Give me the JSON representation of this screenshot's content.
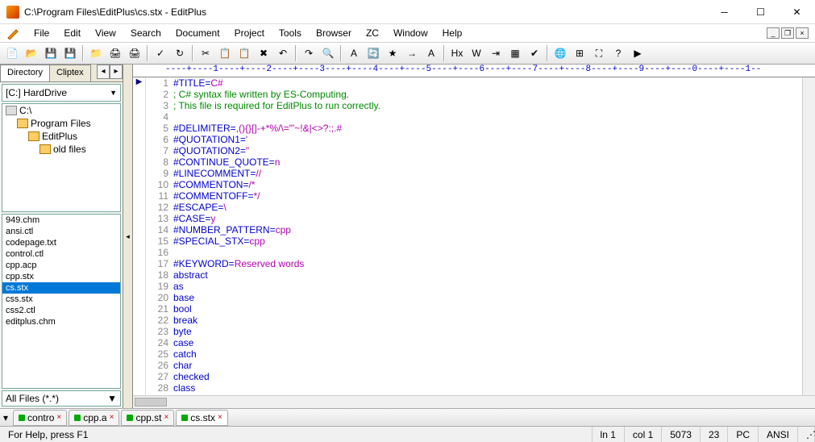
{
  "title": "C:\\Program Files\\EditPlus\\cs.stx - EditPlus",
  "menus": [
    "File",
    "Edit",
    "View",
    "Search",
    "Document",
    "Project",
    "Tools",
    "Browser",
    "ZC",
    "Window",
    "Help"
  ],
  "sidebar": {
    "tabs": [
      "Directory",
      "Cliptex"
    ],
    "drive": "[C:] HardDrive",
    "folders": [
      {
        "label": "C:\\",
        "indent": 0,
        "type": "drive"
      },
      {
        "label": "Program Files",
        "indent": 1,
        "type": "folder"
      },
      {
        "label": "EditPlus",
        "indent": 2,
        "type": "folder-open"
      },
      {
        "label": "old files",
        "indent": 3,
        "type": "folder"
      }
    ],
    "files": [
      "949.chm",
      "ansi.ctl",
      "codepage.txt",
      "control.ctl",
      "cpp.acp",
      "cpp.stx",
      "cs.stx",
      "css.stx",
      "css2.ctl",
      "editplus.chm"
    ],
    "selected_file": "cs.stx",
    "filter": "All Files (*.*)"
  },
  "ruler": "----+----1----+----2----+----3----+----4----+----5----+----6----+----7----+----8----+----9----+----0----+----1--",
  "code": [
    {
      "n": 1,
      "parts": [
        {
          "c": "key",
          "t": "#TITLE="
        },
        {
          "c": "str",
          "t": "C#"
        }
      ],
      "mark": "▶"
    },
    {
      "n": 2,
      "parts": [
        {
          "c": "cmt",
          "t": "; C# syntax file written by ES-Computing."
        }
      ]
    },
    {
      "n": 3,
      "parts": [
        {
          "c": "cmt",
          "t": "; This file is required for EditPlus to run correctly."
        }
      ]
    },
    {
      "n": 4,
      "parts": []
    },
    {
      "n": 5,
      "parts": [
        {
          "c": "key",
          "t": "#DELIMITER="
        },
        {
          "c": "str",
          "t": ",(){}[]-+*%/\\=\"'~!&|<>?:;.#"
        }
      ]
    },
    {
      "n": 6,
      "parts": [
        {
          "c": "key",
          "t": "#QUOTATION1="
        },
        {
          "c": "str",
          "t": "'"
        }
      ]
    },
    {
      "n": 7,
      "parts": [
        {
          "c": "key",
          "t": "#QUOTATION2="
        },
        {
          "c": "str",
          "t": "\""
        }
      ]
    },
    {
      "n": 8,
      "parts": [
        {
          "c": "key",
          "t": "#CONTINUE_QUOTE="
        },
        {
          "c": "str",
          "t": "n"
        }
      ]
    },
    {
      "n": 9,
      "parts": [
        {
          "c": "key",
          "t": "#LINECOMMENT="
        },
        {
          "c": "str",
          "t": "//"
        }
      ]
    },
    {
      "n": 10,
      "parts": [
        {
          "c": "key",
          "t": "#COMMENTON="
        },
        {
          "c": "str",
          "t": "/*"
        }
      ]
    },
    {
      "n": 11,
      "parts": [
        {
          "c": "key",
          "t": "#COMMENTOFF="
        },
        {
          "c": "str",
          "t": "*/"
        }
      ]
    },
    {
      "n": 12,
      "parts": [
        {
          "c": "key",
          "t": "#ESCAPE="
        },
        {
          "c": "str",
          "t": "\\"
        }
      ]
    },
    {
      "n": 13,
      "parts": [
        {
          "c": "key",
          "t": "#CASE="
        },
        {
          "c": "str",
          "t": "y"
        }
      ]
    },
    {
      "n": 14,
      "parts": [
        {
          "c": "key",
          "t": "#NUMBER_PATTERN="
        },
        {
          "c": "str",
          "t": "cpp"
        }
      ]
    },
    {
      "n": 15,
      "parts": [
        {
          "c": "key",
          "t": "#SPECIAL_STX="
        },
        {
          "c": "str",
          "t": "cpp"
        }
      ]
    },
    {
      "n": 16,
      "parts": []
    },
    {
      "n": 17,
      "parts": [
        {
          "c": "key",
          "t": "#KEYWORD="
        },
        {
          "c": "str",
          "t": "Reserved words"
        }
      ]
    },
    {
      "n": 18,
      "parts": [
        {
          "c": "kw",
          "t": "abstract"
        }
      ]
    },
    {
      "n": 19,
      "parts": [
        {
          "c": "kw",
          "t": "as"
        }
      ]
    },
    {
      "n": 20,
      "parts": [
        {
          "c": "kw",
          "t": "base"
        }
      ]
    },
    {
      "n": 21,
      "parts": [
        {
          "c": "kw",
          "t": "bool"
        }
      ]
    },
    {
      "n": 22,
      "parts": [
        {
          "c": "kw",
          "t": "break"
        }
      ]
    },
    {
      "n": 23,
      "parts": [
        {
          "c": "kw",
          "t": "byte"
        }
      ]
    },
    {
      "n": 24,
      "parts": [
        {
          "c": "kw",
          "t": "case"
        }
      ]
    },
    {
      "n": 25,
      "parts": [
        {
          "c": "kw",
          "t": "catch"
        }
      ]
    },
    {
      "n": 26,
      "parts": [
        {
          "c": "kw",
          "t": "char"
        }
      ]
    },
    {
      "n": 27,
      "parts": [
        {
          "c": "kw",
          "t": "checked"
        }
      ]
    },
    {
      "n": 28,
      "parts": [
        {
          "c": "kw",
          "t": "class"
        }
      ]
    }
  ],
  "doc_tabs": [
    {
      "label": "contro",
      "active": false
    },
    {
      "label": "cpp.a",
      "active": false
    },
    {
      "label": "cpp.st",
      "active": false
    },
    {
      "label": "cs.stx",
      "active": true
    }
  ],
  "status": {
    "help": "For Help, press F1",
    "line": "ln 1",
    "col": "col 1",
    "chars": "5073",
    "other": "23",
    "os": "PC",
    "enc": "ANSI"
  },
  "toolbar_icons": [
    "new",
    "open",
    "save",
    "saveall",
    "folder",
    "print",
    "printpreview",
    "spell",
    "redo-arrow",
    "cut",
    "copy",
    "paste",
    "delete",
    "undo",
    "redo",
    "find",
    "findtext",
    "replace",
    "bookmark",
    "next",
    "font",
    "hex",
    "wrap",
    "indent",
    "column",
    "check",
    "browser",
    "split",
    "fullscreen",
    "help",
    "run"
  ]
}
